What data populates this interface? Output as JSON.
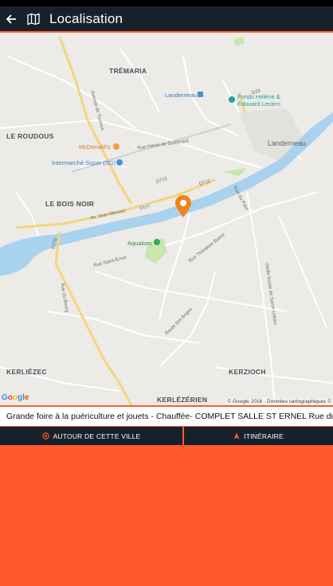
{
  "header": {
    "title": "Localisation",
    "back_icon": "arrow-left-icon",
    "map_icon": "map-icon"
  },
  "map": {
    "labels": {
      "tremaria": "TRÉMARIA",
      "le_roudous": "LE ROUDOUS",
      "le_bois_noir": "LE BOIS NOIR",
      "kerliezec": "KERLIÉZEC",
      "kerzioch": "KERZIOCH",
      "kerlezerien": "KERLÉZÉRIEN",
      "landerneau_town": "Landerneau",
      "landerneau_station": "Landerneau",
      "mcdonalds": "McDonald's",
      "intermarche": "Intermarché Super (SG)",
      "aqualorn": "Aqualorn",
      "fonds": "Fonds Hélène &",
      "fonds2": "Édouard Leclerc",
      "rue_herve": "Rue Hervé de Guébriant",
      "d712_a": "D712",
      "d712_b": "D712",
      "d770": "D770",
      "d29": "D29",
      "elorn": "Elorn",
      "av_jean_monnet": "Av. Jean Monnet",
      "rue_theodore": "Rue Théodore Botrel",
      "rue_saint_ernel": "Rue Saint-Ernel",
      "route_des_anges": "Route des Anges",
      "vieille_route": "Vieille Route de Sanm-Urbain",
      "rue_du_pont": "Rue du Pont",
      "av_tourous": "Avenue de Tourous",
      "rue_bourg": "Rue du Bourg"
    },
    "google_logo": "Google",
    "copyright": "© Google 2018 - Données cartographiques ©"
  },
  "ticker": {
    "text": "Grande foire à la puériculture et jouets - Chauffée- COMPLET SALLE ST ERNEL Rue du C"
  },
  "actions": {
    "around_city": "AUTOUR DE CETTE VILLE",
    "itinerary": "ITINÉRAIRE"
  },
  "colors": {
    "accent": "#ff5a2e",
    "bar": "#17212c",
    "water": "#a8d2ee",
    "park": "#c8e6b0"
  }
}
